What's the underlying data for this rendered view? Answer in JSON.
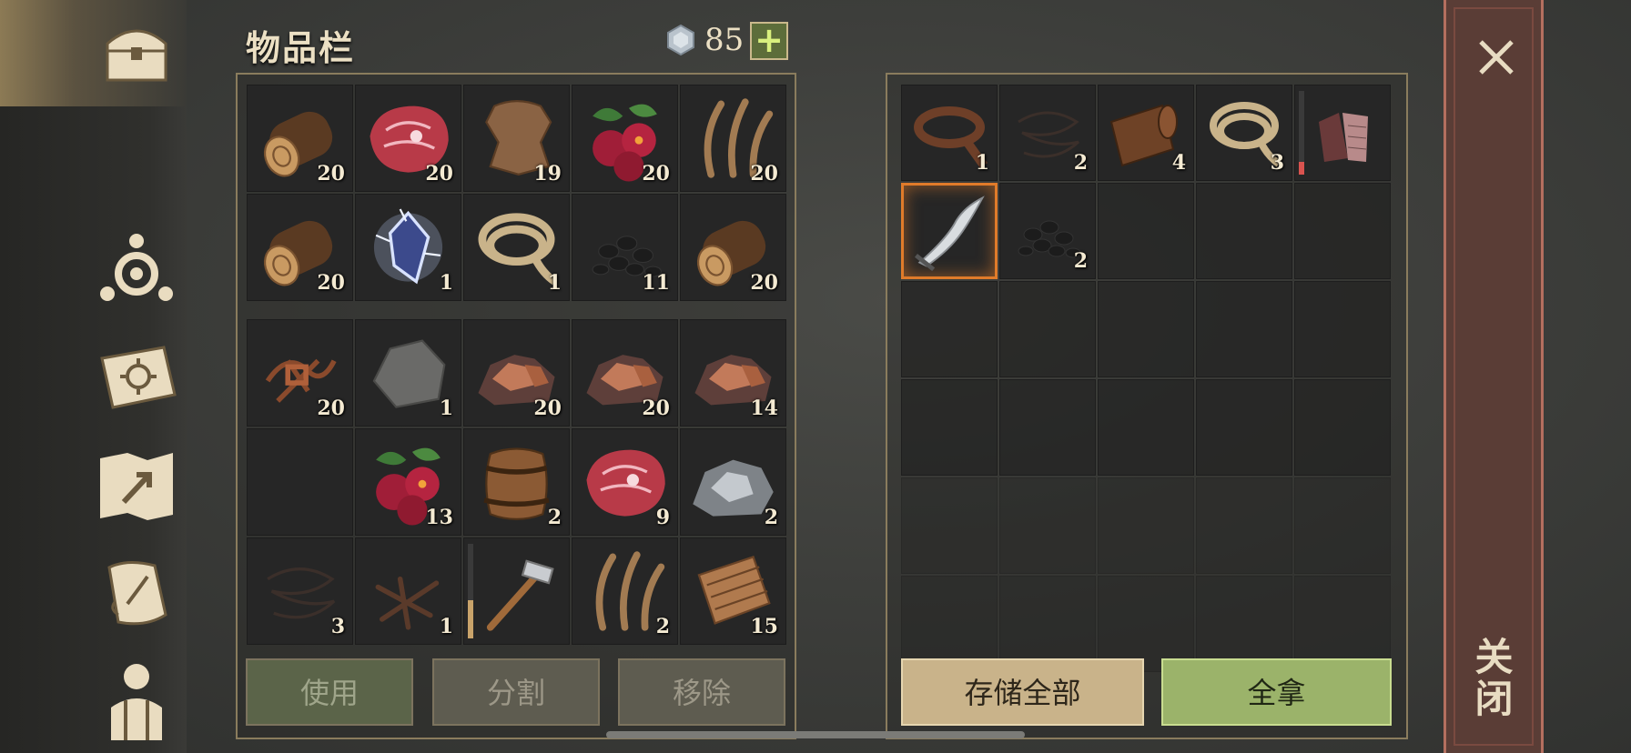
{
  "inventory": {
    "title": "物品栏",
    "currency_icon": "silver-gem-icon",
    "currency_count": "85",
    "add_label": "+",
    "grid_top": [
      {
        "icon": "log",
        "count": "20"
      },
      {
        "icon": "raw-meat",
        "count": "20"
      },
      {
        "icon": "leather-hide",
        "count": "19"
      },
      {
        "icon": "berries",
        "count": "20"
      },
      {
        "icon": "plant-fiber",
        "count": "20"
      },
      {
        "icon": "log",
        "count": "20"
      },
      {
        "icon": "crystal",
        "count": "1"
      },
      {
        "icon": "rope",
        "count": "1"
      },
      {
        "icon": "charcoal",
        "count": "11"
      },
      {
        "icon": "log",
        "count": "20"
      }
    ],
    "grid_bottom": [
      {
        "icon": "copper-scrap",
        "count": "20"
      },
      {
        "icon": "stone",
        "count": "1"
      },
      {
        "icon": "copper-ore",
        "count": "20"
      },
      {
        "icon": "copper-ore",
        "count": "20"
      },
      {
        "icon": "copper-ore",
        "count": "14"
      },
      {
        "icon": "empty",
        "count": ""
      },
      {
        "icon": "berries",
        "count": "13"
      },
      {
        "icon": "barrel",
        "count": "2"
      },
      {
        "icon": "raw-meat",
        "count": "9"
      },
      {
        "icon": "iron-ore",
        "count": "2"
      },
      {
        "icon": "wire",
        "count": "3"
      },
      {
        "icon": "nails",
        "count": "1"
      },
      {
        "icon": "hammer",
        "count": "",
        "durability": 0.4,
        "durability_color": "#c9a36a"
      },
      {
        "icon": "plant-fiber",
        "count": "2"
      },
      {
        "icon": "woven-fabric",
        "count": "15"
      }
    ],
    "buttons": {
      "use": "使用",
      "split": "分割",
      "remove": "移除"
    }
  },
  "container": {
    "grid": [
      {
        "icon": "leather-strap",
        "count": "1"
      },
      {
        "icon": "wire",
        "count": "2"
      },
      {
        "icon": "leather-roll",
        "count": "4"
      },
      {
        "icon": "rope",
        "count": "3"
      },
      {
        "icon": "chainmail-gloves",
        "count": "",
        "durability": 0.15,
        "durability_color": "#d9534f"
      },
      {
        "icon": "curved-blade",
        "count": "",
        "selected": true
      },
      {
        "icon": "charcoal",
        "count": "2"
      }
    ],
    "buttons": {
      "store_all": "存储全部",
      "take_all": "全拿"
    }
  },
  "close": {
    "label": "关闭"
  },
  "nav": [
    "chest-icon",
    "crafting-icon",
    "sun-book-icon",
    "map-icon",
    "scroll-icon",
    "character-icon"
  ],
  "colors": {
    "accent_green": "#9bb36a",
    "selection": "#e07b2a",
    "close_strip": "#5a3d36"
  }
}
